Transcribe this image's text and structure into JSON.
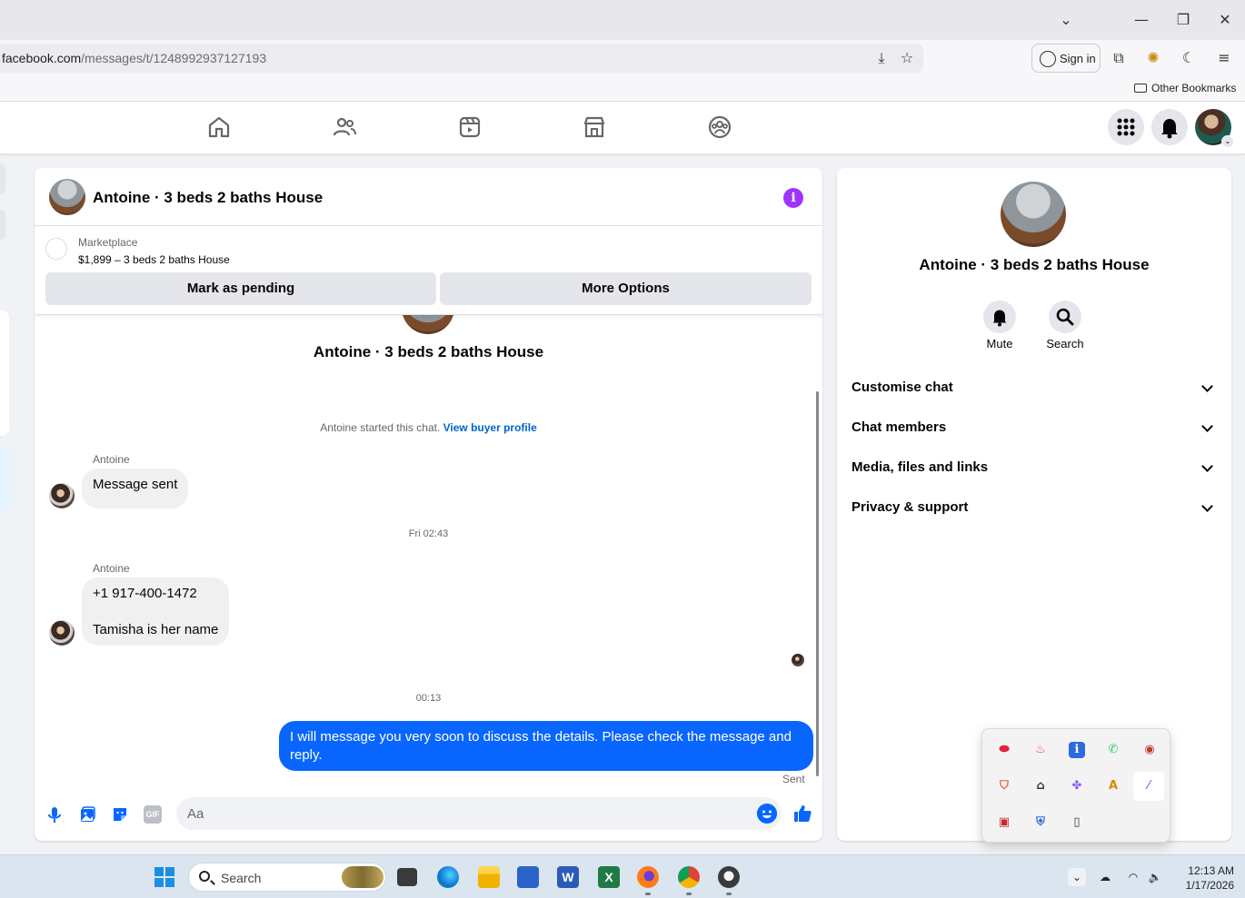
{
  "browser": {
    "url_domain": "facebook.com",
    "url_path": "/messages/t/1248992937127193",
    "sign_in_label": "Sign in",
    "other_bookmarks": "Other Bookmarks"
  },
  "chat": {
    "title": "Antoine · 3 beds 2 baths House",
    "marketplace_label": "Marketplace",
    "listing_text": "$1,899 – 3 beds 2 baths House",
    "mark_pending_label": "Mark as pending",
    "more_options_label": "More Options",
    "conversation_title": "Antoine · 3 beds 2 baths House",
    "started_text": "Antoine started this chat.",
    "view_buyer_profile": "View buyer profile",
    "messages": [
      {
        "sender": "Antoine",
        "text": "Message sent"
      },
      {
        "timestamp": "Fri 02:43"
      },
      {
        "sender": "Antoine",
        "line1": "+1 917-400-1472",
        "line2": "Tamisha is her name"
      },
      {
        "timestamp": "00:13"
      },
      {
        "text": "I will message you very soon to discuss the details. Please check the message and reply.",
        "status": "Sent"
      }
    ],
    "composer_placeholder": "Aa",
    "gif_label": "GIF"
  },
  "info_panel": {
    "name": "Antoine · 3 beds 2 baths House",
    "mute_label": "Mute",
    "search_label": "Search",
    "sections": [
      "Customise chat",
      "Chat members",
      "Media, files and links",
      "Privacy & support"
    ]
  },
  "taskbar": {
    "search_label": "Search",
    "time": "12:13 AM",
    "date": "1/17/2026"
  },
  "colors": {
    "accent_blue": "#0866ff",
    "link_blue": "#0064d1",
    "info_purple": "#a033ff"
  }
}
